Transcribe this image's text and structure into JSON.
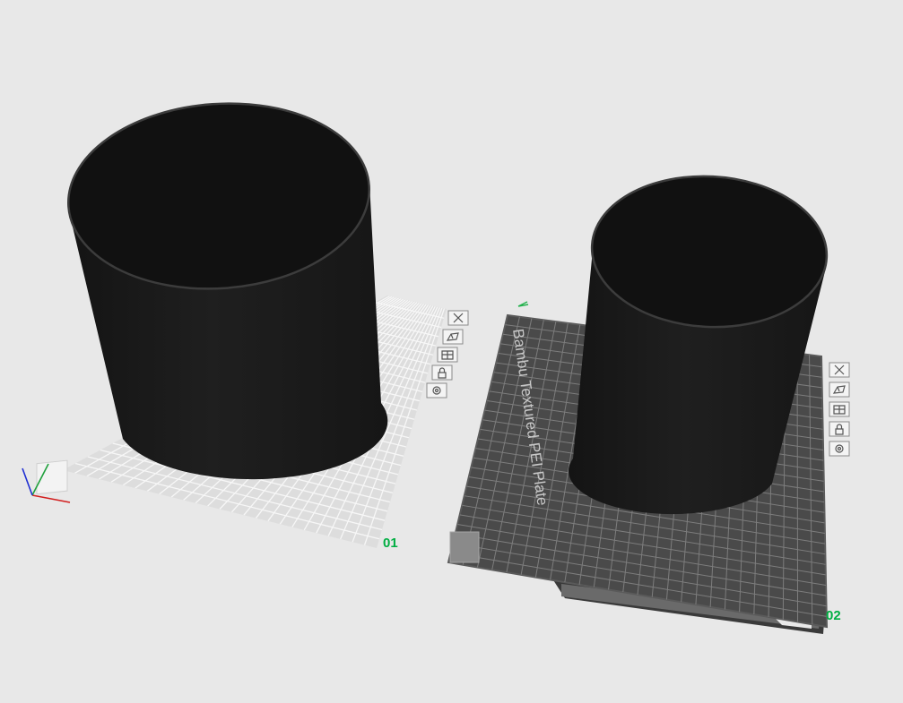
{
  "scene": {
    "plates": [
      {
        "id": "plate-1",
        "number": "01",
        "selected": false,
        "object": "cylinder"
      },
      {
        "id": "plate-2",
        "number": "02",
        "selected": true,
        "plate_type": "Bambu Textured PEI Plate",
        "object": "cylinder"
      }
    ],
    "plate_toolbar": [
      {
        "action": "remove-plate",
        "icon": "close-icon"
      },
      {
        "action": "auto-orient",
        "icon": "orient-icon"
      },
      {
        "action": "arrange",
        "icon": "arrange-icon"
      },
      {
        "action": "lock-plate",
        "icon": "lock-icon"
      },
      {
        "action": "plate-settings",
        "icon": "settings-icon"
      }
    ]
  },
  "colors": {
    "background": "#e8e8e8",
    "plate_number": "#00ae42",
    "object": "#1a1a1a",
    "textured_plate": "#4a4a4a",
    "empty_plate": "#dddddd"
  }
}
